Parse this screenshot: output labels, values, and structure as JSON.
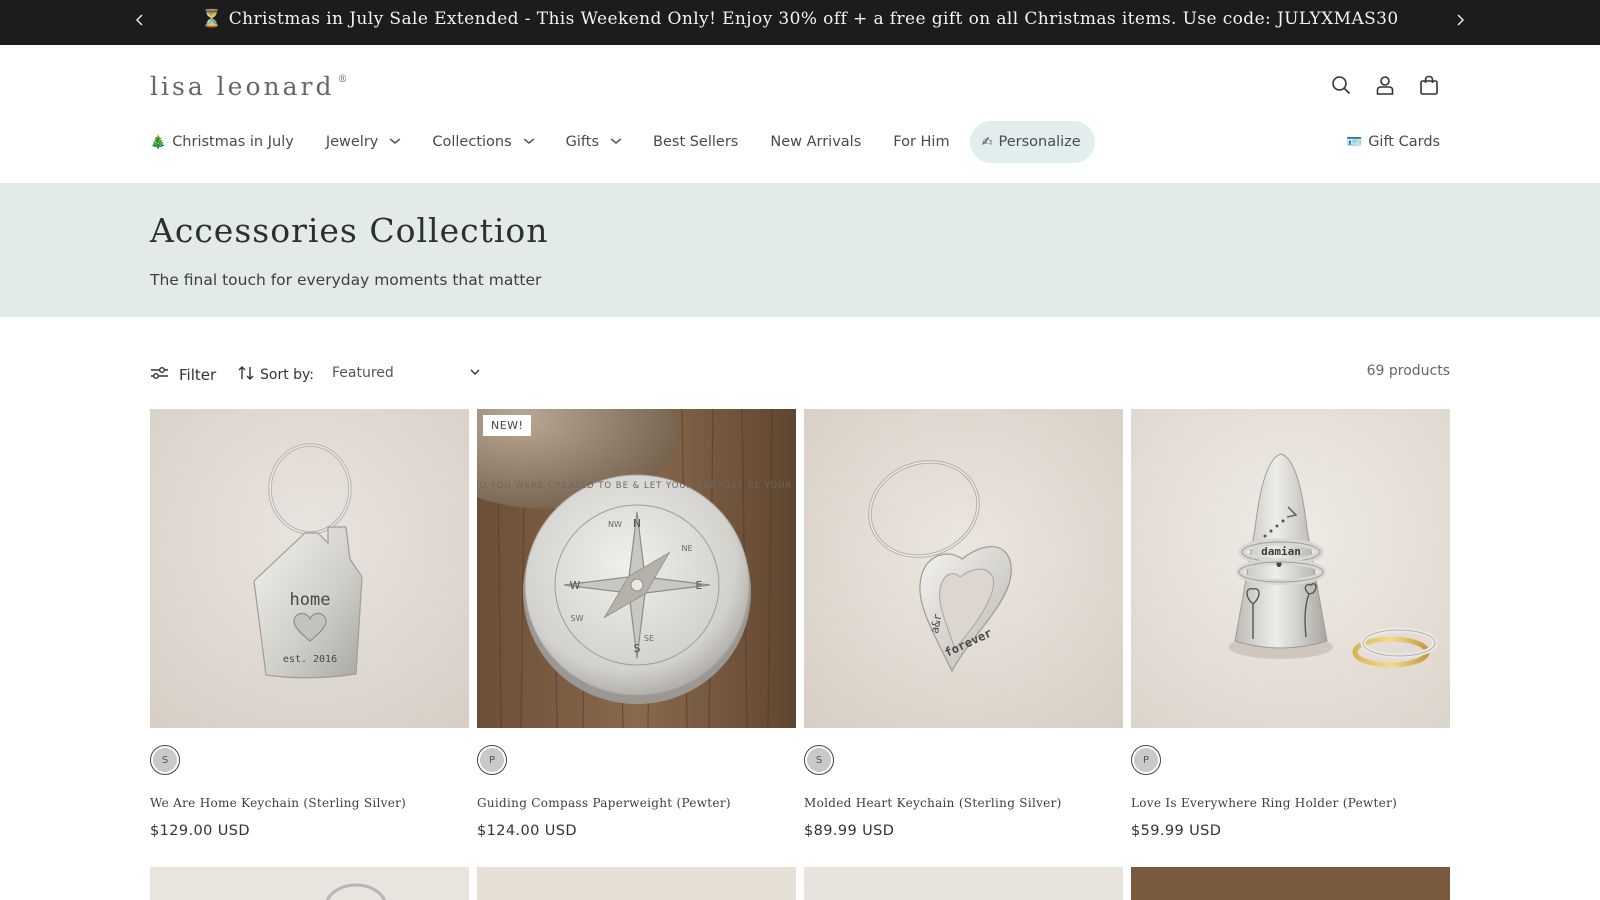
{
  "announcement": {
    "text": "⏳ Christmas in July Sale Extended - This Weekend Only! Enjoy 30% off + a free gift on all Christmas items. Use code: JULYXMAS30",
    "prev_icon": "chevron-left-icon",
    "next_icon": "chevron-right-icon"
  },
  "header": {
    "logo_text": "lisa leonard",
    "logo_mark": "®",
    "icons": [
      "search-icon",
      "account-icon",
      "cart-icon"
    ]
  },
  "nav": {
    "items": [
      {
        "emoji": "🎄",
        "label": "Christmas in July",
        "has_dropdown": false
      },
      {
        "label": "Jewelry",
        "has_dropdown": true
      },
      {
        "label": "Collections",
        "has_dropdown": true
      },
      {
        "label": "Gifts",
        "has_dropdown": true
      },
      {
        "label": "Best Sellers",
        "has_dropdown": false
      },
      {
        "label": "New Arrivals",
        "has_dropdown": false
      },
      {
        "label": "For Him",
        "has_dropdown": false
      },
      {
        "emoji": "✍",
        "label": "Personalize",
        "has_dropdown": false,
        "highlighted": true
      }
    ],
    "gift_cards": {
      "emoji": "🪪",
      "label": "Gift Cards"
    }
  },
  "hero": {
    "title": "Accessories Collection",
    "subtitle": "The final touch for everyday moments that matter",
    "background": "#e2ebe8"
  },
  "toolbar": {
    "filter_label": "Filter",
    "sort_label": "Sort by:",
    "sort_value": "Featured",
    "product_count": "69 products"
  },
  "products": [
    {
      "title": "We Are Home Keychain (Sterling Silver)",
      "price": "$129.00 USD",
      "swatch": "S",
      "badge": ""
    },
    {
      "title": "Guiding Compass Paperweight (Pewter)",
      "price": "$124.00 USD",
      "swatch": "P",
      "badge": "NEW!"
    },
    {
      "title": "Molded Heart Keychain (Sterling Silver)",
      "price": "$89.99 USD",
      "swatch": "S",
      "badge": ""
    },
    {
      "title": "Love Is Everywhere Ring Holder (Pewter)",
      "price": "$59.99 USD",
      "swatch": "P",
      "badge": ""
    }
  ],
  "image_text": {
    "keychain_home": "home",
    "keychain_est": "est. 2016",
    "compass_ring": "BE WHO YOU WERE CREATED TO BE & LET YOUR PURPOSE BE YOUR GUIDE",
    "compass_n": "N",
    "compass_s": "S",
    "compass_e": "E",
    "compass_w": "W",
    "compass_ne": "NE",
    "compass_nw": "NW",
    "compass_se": "SE",
    "compass_sw": "SW",
    "heart_initials": "a&r",
    "heart_word": "forever",
    "ring_name": "damian"
  },
  "colors": {
    "announcement_bg": "#1c1c1c",
    "hero_bg": "#e2ebe8",
    "pill_bg": "#e2eeee"
  }
}
